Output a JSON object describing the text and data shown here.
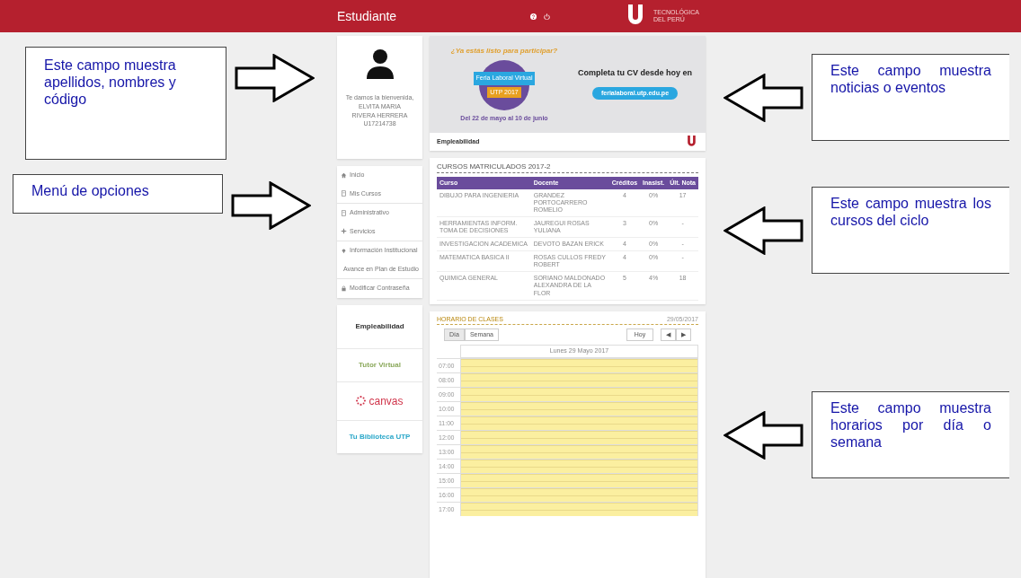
{
  "header": {
    "title": "Estudiante",
    "logo_lines": [
      "TECNOLÓGICA",
      "DEL PERÚ"
    ]
  },
  "profile": {
    "greeting": "Te damos la bienvenida,",
    "names": "ELVITA MARIA",
    "surnames": "RIVERA HERRERA",
    "code": "U17214738"
  },
  "menu": [
    {
      "label": "Inicio"
    },
    {
      "label": "Mis Cursos"
    },
    {
      "label": "Administrativo"
    },
    {
      "label": "Servicios"
    },
    {
      "label": "Información Institucional"
    },
    {
      "label": "Avance en Plan de Estudio"
    },
    {
      "label": "Modificar Contraseña"
    }
  ],
  "links": [
    {
      "kind": "empleabilidad",
      "label": "Empleabilidad"
    },
    {
      "kind": "tutor",
      "label": "Tutor Virtual"
    },
    {
      "kind": "canvas",
      "label": "canvas"
    },
    {
      "kind": "biblioteca",
      "label": "Tu Biblioteca UTP"
    }
  ],
  "banner": {
    "headline": "¿Ya estás listo para participar?",
    "event": "Feria Laboral Virtual",
    "year": "UTP 2017",
    "dates": "Del 22 de mayo al 10 de junio",
    "cta": "Completa tu CV desde hoy en",
    "url": "ferialaboral.utp.edu.pe",
    "footer_brand": "Empleabilidad"
  },
  "courses": {
    "title": "CURSOS MATRICULADOS 2017-2",
    "columns": [
      "Curso",
      "Docente",
      "Créditos",
      "Inasist.",
      "Últ. Nota"
    ],
    "rows": [
      [
        "DIBUJO PARA INGENIERIA",
        "GRANDEZ PORTOCARRERO ROMELIO",
        "4",
        "0%",
        "17"
      ],
      [
        "HERRAMIENTAS INFORM. TOMA DE DECISIONES",
        "JAUREGUI ROSAS YULIANA",
        "3",
        "0%",
        "-"
      ],
      [
        "INVESTIGACION ACADEMICA",
        "DEVOTO BAZAN ERICK",
        "4",
        "0%",
        "-"
      ],
      [
        "MATEMATICA BASICA II",
        "ROSAS CULLOS FREDY ROBERT",
        "4",
        "0%",
        "-"
      ],
      [
        "QUIMICA GENERAL",
        "SORIANO MALDONADO ALEXANDRA DE LA FLOR",
        "5",
        "4%",
        "18"
      ]
    ]
  },
  "schedule": {
    "title": "HORARIO DE CLASES",
    "date_short": "29/05/2017",
    "views": [
      {
        "label": "Día",
        "selected": true
      },
      {
        "label": "Semana",
        "selected": false
      }
    ],
    "today": "Hoy",
    "nav": [
      "◀",
      "▶"
    ],
    "day_heading": "Lunes 29 Mayo 2017",
    "hours": [
      "07:00",
      "08:00",
      "09:00",
      "10:00",
      "11:00",
      "12:00",
      "13:00",
      "14:00",
      "15:00",
      "16:00",
      "17:00"
    ]
  },
  "annotations_left": [
    {
      "text": "Este campo muestra apellidos, nombres y código"
    },
    {
      "text": "Menú de opciones"
    }
  ],
  "annotations_right": [
    {
      "text": "Este campo muestra noticias o eventos"
    },
    {
      "text": "Este campo muestra los cursos del ciclo"
    },
    {
      "text": "Este campo muestra horarios por día o semana"
    }
  ]
}
